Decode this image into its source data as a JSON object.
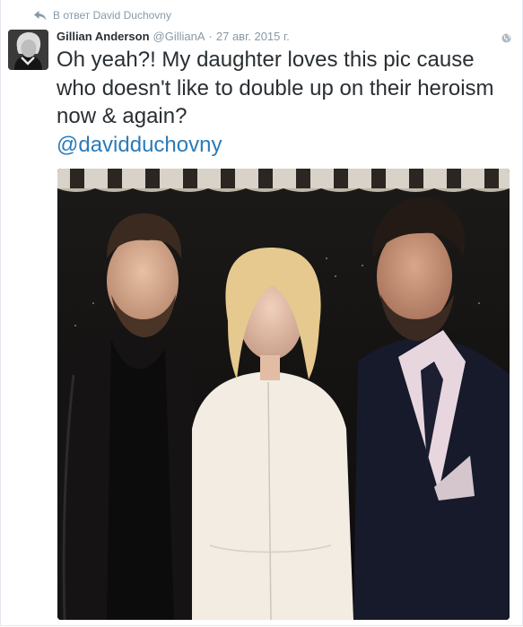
{
  "reply_context": {
    "text": "В ответ David Duchovny"
  },
  "tweet": {
    "author_name": "Gillian Anderson",
    "author_handle": "@GillianA",
    "separator": "·",
    "timestamp": "27 авг. 2015 г.",
    "text": "Oh yeah?! My daughter loves this pic cause who doesn't like to double up on their heroism now & again?",
    "mention": "@davidduchovny"
  },
  "icons": {
    "reply_context": "reply-arrow-icon",
    "location": "globe-icon"
  },
  "colors": {
    "link": "#2b7bb9",
    "secondary_text": "#8899a6",
    "primary_text": "#292f33"
  }
}
